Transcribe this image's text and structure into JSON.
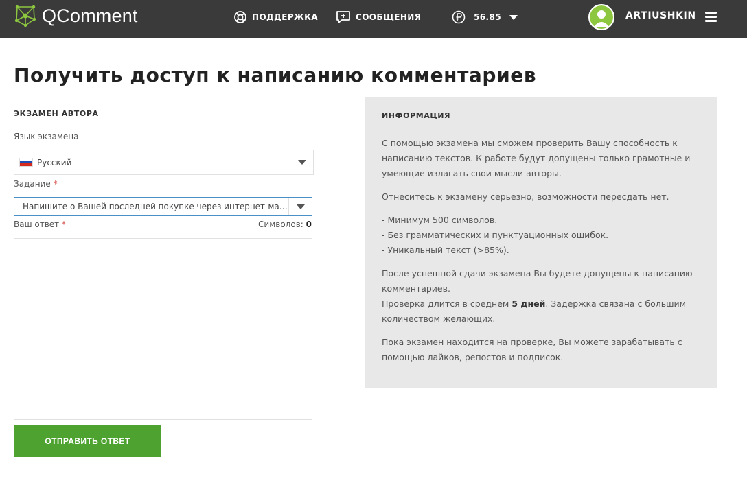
{
  "header": {
    "logo_text": "QComment",
    "support": "ПОДДЕРЖКА",
    "messages": "СООБЩЕНИЯ",
    "balance": "56.85",
    "username": "ARTIUSHKIN",
    "bg_color": "#3a3a3a",
    "accent_color": "#8dc63f"
  },
  "page": {
    "title": "Получить доступ к написанию комментариев"
  },
  "form": {
    "section": "ЭКЗАМЕН АВТОРА",
    "lang_label": "Язык экзамена",
    "lang_value": "Русский",
    "task_label": "Задание",
    "task_value": "Напишите о Вашей последней покупке через интернет-магазин",
    "answer_label": "Ваш ответ",
    "required_mark": "*",
    "chars_label": "Символов:",
    "chars_count": "0",
    "answer_value": "",
    "submit": "ОТПРАВИТЬ ОТВЕТ",
    "submit_color": "#4ea22f"
  },
  "info": {
    "title": "ИНФОРМАЦИЯ",
    "p1": "С помощью экзамена мы сможем проверить Вашу способность к написанию текстов. К работе будут допущены только грамотные и умеющие излагать свои мысли авторы.",
    "p2": "Отнеситесь к экзамену серьезно, возможности пересдать нет.",
    "req1": "- Минимум 500 символов.",
    "req2": "- Без грамматических и пунктуационных ошибок.",
    "req3": "- Уникальный текст (>85%).",
    "p4": "После успешной сдачи экзамена Вы будете допущены к написанию комментариев.",
    "p5_pre": "Проверка длится в среднем ",
    "p5_bold": "5 дней",
    "p5_post": ". Задержка связана с большим количеством желающих.",
    "p6": "Пока экзамен находится на проверке, Вы можете зарабатывать с помощью лайков, репостов и подписок."
  },
  "icons": {
    "logo": "network-logo-icon",
    "support": "lifebuoy-icon",
    "messages": "message-plus-icon",
    "currency": "ruble-coin-icon",
    "balance_toggle": "caret-down-icon",
    "avatar": "user-avatar-icon",
    "menu": "hamburger-menu-icon",
    "flag": "russia-flag-icon",
    "select_toggle": "caret-down-icon"
  }
}
